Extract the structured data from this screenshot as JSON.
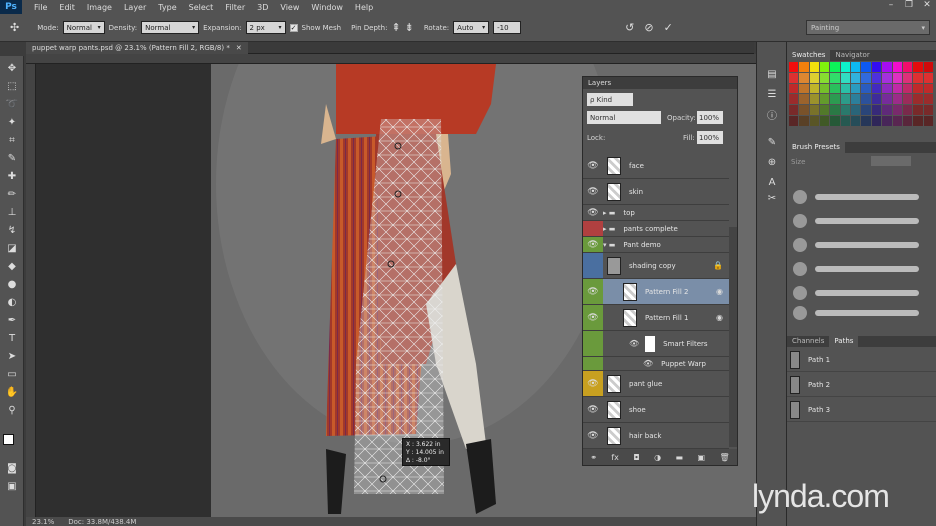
{
  "app": {
    "logo": "Ps"
  },
  "menu": [
    "File",
    "Edit",
    "Image",
    "Layer",
    "Type",
    "Select",
    "Filter",
    "3D",
    "View",
    "Window",
    "Help"
  ],
  "options": {
    "mode_label": "Mode:",
    "mode_value": "Normal",
    "density_label": "Density:",
    "density_value": "Normal",
    "expansion_label": "Expansion:",
    "expansion_value": "2 px",
    "show_mesh_label": "Show Mesh",
    "pin_depth_label": "Pin Depth:",
    "rotate_label": "Rotate:",
    "rotate_value": "Auto",
    "rotate_angle": "-10"
  },
  "workspace": "Painting",
  "document_tab": "puppet warp pants.psd @ 23.1% (Pattern Fill 2, RGB/8) *",
  "info_popup": {
    "x": "X : 3.622 in",
    "y": "Y : 14.005 in",
    "angle": "∆ : -8.0°"
  },
  "status": {
    "zoom": "23.1%",
    "doc": "Doc: 33.8M/438.4M"
  },
  "layers_panel": {
    "title": "Layers",
    "kind": "ρ Kind",
    "blend": "Normal",
    "opacity_label": "Opacity:",
    "opacity_value": "100%",
    "lock_label": "Lock:",
    "fill_label": "Fill:",
    "fill_value": "100%",
    "rows": [
      "face",
      "skin",
      "top",
      "pants complete",
      "Pant demo",
      "shading copy",
      "Pattern Fill 2",
      "Pattern Fill 1",
      "Smart Filters",
      "Puppet Warp",
      "pant glue",
      "shoe",
      "hair back"
    ]
  },
  "swatch_tabs": [
    "Swatches",
    "Navigator"
  ],
  "brush_tabs": [
    "Brush Presets"
  ],
  "brush_size_label": "Size",
  "paths_tabs": [
    "Channels",
    "Paths"
  ],
  "paths": [
    "Path 1",
    "Path 2",
    "Path 3"
  ],
  "watermark": "lynda.com",
  "colors": {
    "selected_layer": "#7a8ea8",
    "green_tag": "#6a9a3c",
    "blue_tag": "#4a6fa0",
    "red_tag": "#b04040",
    "yellow_tag": "#c8a020",
    "pants": "#a2382a"
  }
}
